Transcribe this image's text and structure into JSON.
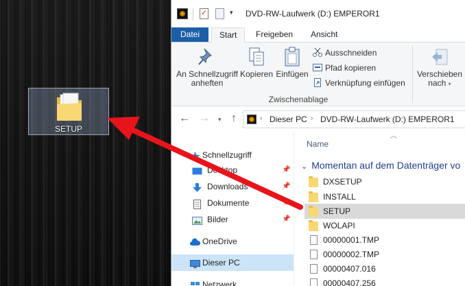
{
  "desktop": {
    "icon_label": "SETUP"
  },
  "window": {
    "title": "DVD-RW-Laufwerk (D:) EMPEROR1"
  },
  "tabs": {
    "file": "Datei",
    "start": "Start",
    "share": "Freigeben",
    "view": "Ansicht"
  },
  "ribbon": {
    "pin_line1": "An Schnellzugriff",
    "pin_line2": "anheften",
    "copy": "Kopieren",
    "paste": "Einfügen",
    "cut": "Ausschneiden",
    "copy_path": "Pfad kopieren",
    "paste_shortcut": "Verknüpfung einfügen",
    "group_clipboard": "Zwischenablage",
    "move_line1": "Verschieben",
    "move_line2": "nach"
  },
  "address": {
    "segment1": "Dieser PC",
    "segment2": "DVD-RW-Laufwerk (D:) EMPEROR1"
  },
  "navpane": {
    "items": [
      {
        "label": "Schnellzugriff"
      },
      {
        "label": "Desktop"
      },
      {
        "label": "Downloads"
      },
      {
        "label": "Dokumente"
      },
      {
        "label": "Bilder"
      },
      {
        "label": "OneDrive"
      },
      {
        "label": "Dieser PC"
      },
      {
        "label": "Netzwerk"
      }
    ]
  },
  "content": {
    "column_name": "Name",
    "group_header": "Momentan auf dem Datenträger vo",
    "files": [
      {
        "name": "DXSETUP",
        "type": "folder"
      },
      {
        "name": "INSTALL",
        "type": "folder"
      },
      {
        "name": "SETUP",
        "type": "folder"
      },
      {
        "name": "WOLAPI",
        "type": "folder"
      },
      {
        "name": "00000001.TMP",
        "type": "file"
      },
      {
        "name": "00000002.TMP",
        "type": "file"
      },
      {
        "name": "00000407.016",
        "type": "file"
      },
      {
        "name": "00000407.256",
        "type": "file"
      }
    ]
  },
  "colors": {
    "file_tab": "#1c5fa8",
    "selection": "#cce4f7",
    "arrow": "#e8141b",
    "group_header": "#1e3f8a"
  }
}
